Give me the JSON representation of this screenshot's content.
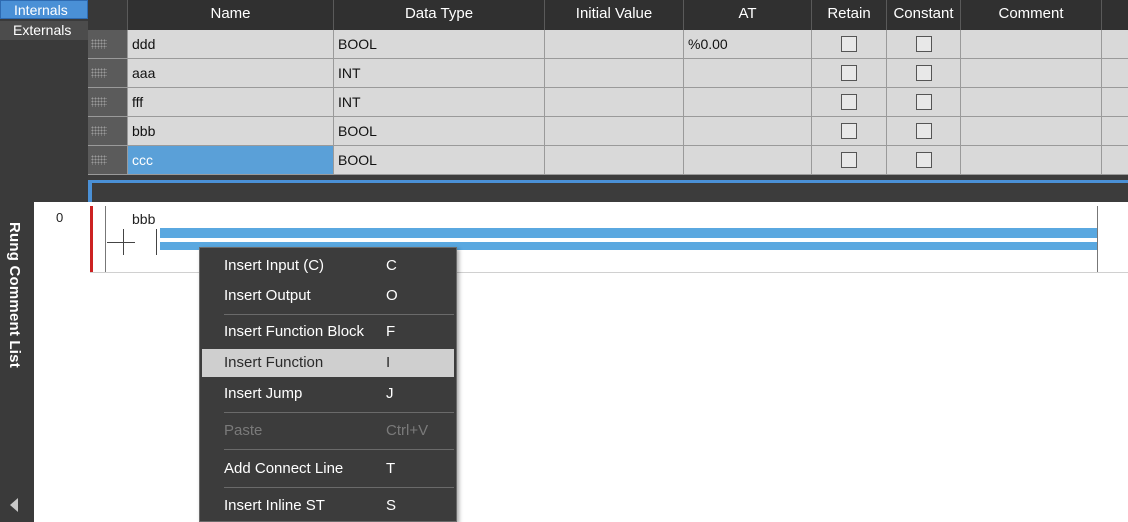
{
  "side_tabs": [
    {
      "label": "Internals"
    },
    {
      "label": "Externals"
    }
  ],
  "table": {
    "columns": [
      "Name",
      "Data Type",
      "Initial Value",
      "AT",
      "Retain",
      "Constant",
      "Comment"
    ],
    "rows": [
      {
        "name": "ddd",
        "data_type": "BOOL",
        "initial_value": "",
        "at": "%0.00",
        "retain": false,
        "constant": false,
        "comment": ""
      },
      {
        "name": "aaa",
        "data_type": "INT",
        "initial_value": "",
        "at": "",
        "retain": false,
        "constant": false,
        "comment": ""
      },
      {
        "name": "fff",
        "data_type": "INT",
        "initial_value": "",
        "at": "",
        "retain": false,
        "constant": false,
        "comment": ""
      },
      {
        "name": "bbb",
        "data_type": "BOOL",
        "initial_value": "",
        "at": "",
        "retain": false,
        "constant": false,
        "comment": ""
      },
      {
        "name": "ccc",
        "data_type": "BOOL",
        "initial_value": "",
        "at": "",
        "retain": false,
        "constant": false,
        "comment": "",
        "selected": true
      }
    ]
  },
  "rung_comment_list": {
    "label": "Rung Comment List"
  },
  "ladder": {
    "rung_number": "0",
    "contact_label": "bbb"
  },
  "context_menu": {
    "items": [
      {
        "label": "Insert Input (C)",
        "key": "C"
      },
      {
        "label": "Insert Output",
        "key": "O"
      },
      {
        "label": "Insert Function Block",
        "key": "F"
      },
      {
        "label": "Insert Function",
        "key": "I",
        "hover": true
      },
      {
        "label": "Insert Jump",
        "key": "J"
      },
      {
        "label": "Paste",
        "key": "Ctrl+V",
        "disabled": true
      },
      {
        "label": "Add Connect Line",
        "key": "T"
      },
      {
        "label": "Insert Inline ST",
        "key": "S"
      }
    ]
  },
  "colors": {
    "accent": "#4a90d6",
    "selection": "#5aa8e0",
    "power_rail": "#cc2222",
    "panel_dark": "#3a3a3a"
  }
}
